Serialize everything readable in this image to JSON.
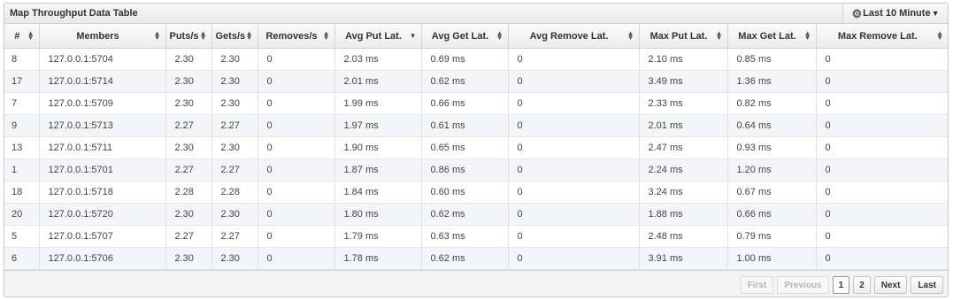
{
  "panel": {
    "title": "Map Throughput Data Table",
    "time_range": "Last 10 Minute"
  },
  "table": {
    "columns": [
      {
        "label": "#",
        "sort": "both"
      },
      {
        "label": "Members",
        "sort": "both"
      },
      {
        "label": "Puts/s",
        "sort": "both"
      },
      {
        "label": "Gets/s",
        "sort": "both"
      },
      {
        "label": "Removes/s",
        "sort": "both"
      },
      {
        "label": "Avg Put Lat.",
        "sort": "desc"
      },
      {
        "label": "Avg Get Lat.",
        "sort": "both"
      },
      {
        "label": "Avg Remove Lat.",
        "sort": "both"
      },
      {
        "label": "Max Put Lat.",
        "sort": "both"
      },
      {
        "label": "Max Get Lat.",
        "sort": "both"
      },
      {
        "label": "Max Remove Lat.",
        "sort": "both"
      }
    ],
    "rows": [
      [
        "8",
        "127.0.0.1:5704",
        "2.30",
        "2.30",
        "0",
        "2.03 ms",
        "0.69 ms",
        "0",
        "2.10 ms",
        "0.85 ms",
        "0"
      ],
      [
        "17",
        "127.0.0.1:5714",
        "2.30",
        "2.30",
        "0",
        "2.01 ms",
        "0.62 ms",
        "0",
        "3.49 ms",
        "1.36 ms",
        "0"
      ],
      [
        "7",
        "127.0.0.1:5709",
        "2.30",
        "2.30",
        "0",
        "1.99 ms",
        "0.66 ms",
        "0",
        "2.33 ms",
        "0.82 ms",
        "0"
      ],
      [
        "9",
        "127.0.0.1:5713",
        "2.27",
        "2.27",
        "0",
        "1.97 ms",
        "0.61 ms",
        "0",
        "2.01 ms",
        "0.64 ms",
        "0"
      ],
      [
        "13",
        "127.0.0.1:5711",
        "2.30",
        "2.30",
        "0",
        "1.90 ms",
        "0.65 ms",
        "0",
        "2.47 ms",
        "0.93 ms",
        "0"
      ],
      [
        "1",
        "127.0.0.1:5701",
        "2.27",
        "2.27",
        "0",
        "1.87 ms",
        "0.86 ms",
        "0",
        "2.24 ms",
        "1.20 ms",
        "0"
      ],
      [
        "18",
        "127.0.0.1:5718",
        "2.28",
        "2.28",
        "0",
        "1.84 ms",
        "0.60 ms",
        "0",
        "3.24 ms",
        "0.67 ms",
        "0"
      ],
      [
        "20",
        "127.0.0.1:5720",
        "2.30",
        "2.30",
        "0",
        "1.80 ms",
        "0.62 ms",
        "0",
        "1.88 ms",
        "0.66 ms",
        "0"
      ],
      [
        "5",
        "127.0.0.1:5707",
        "2.27",
        "2.27",
        "0",
        "1.79 ms",
        "0.63 ms",
        "0",
        "2.48 ms",
        "0.79 ms",
        "0"
      ],
      [
        "6",
        "127.0.0.1:5706",
        "2.30",
        "2.30",
        "0",
        "1.78 ms",
        "0.62 ms",
        "0",
        "3.91 ms",
        "1.00 ms",
        "0"
      ]
    ]
  },
  "pagination": {
    "first": "First",
    "previous": "Previous",
    "pages": [
      "1",
      "2"
    ],
    "current_page": "1",
    "next": "Next",
    "last": "Last"
  },
  "icons": {
    "settings": "gear-icon",
    "dropdown": "caret-down-icon",
    "sort_both": "sort-icon",
    "sort_desc": "sort-desc-icon"
  },
  "colors": {
    "alt_row": "#f4f5f8",
    "header_bg": "#ededed",
    "border": "#c8c8c8"
  }
}
